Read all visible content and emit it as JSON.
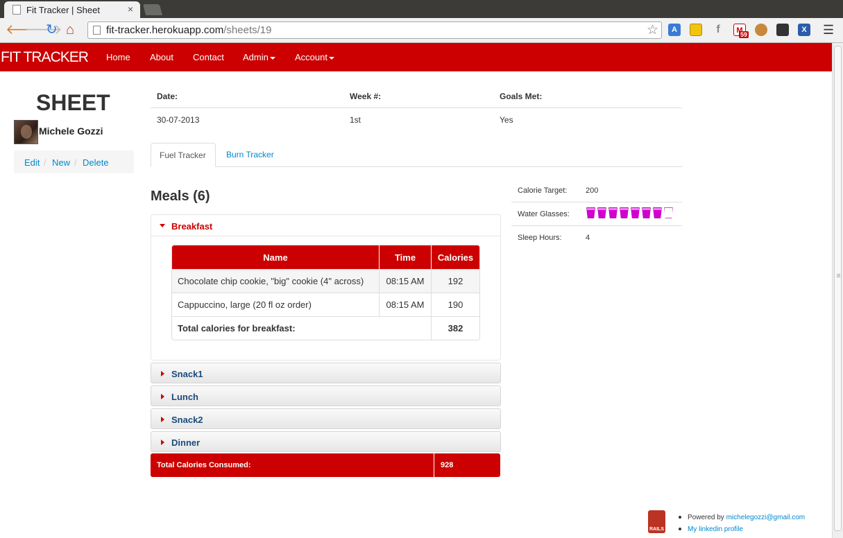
{
  "browser": {
    "tab_title": "Fit Tracker | Sheet",
    "url_host": "fit-tracker.herokuapp.com",
    "url_path": "/sheets/19",
    "gmail_badge": "59"
  },
  "nav": {
    "brand": "FIT TRACKER",
    "links": [
      "Home",
      "About",
      "Contact",
      "Admin",
      "Account"
    ]
  },
  "sheet": {
    "title": "SHEET",
    "user": "Michele Gozzi",
    "actions": [
      "Edit",
      "New",
      "Delete"
    ],
    "separator": "/",
    "info_headers": [
      "Date:",
      "Week #:",
      "Goals Met:"
    ],
    "info_values": [
      "30-07-2013",
      "1st",
      "Yes"
    ]
  },
  "tabs": [
    "Fuel Tracker",
    "Burn Tracker"
  ],
  "meals": {
    "title": "Meals (6)",
    "breakfast": {
      "label": "Breakfast",
      "columns": [
        "Name",
        "Time",
        "Calories"
      ],
      "rows": [
        {
          "name": "Chocolate chip cookie, \"big\" cookie (4\" across)",
          "time": "08:15 AM",
          "calories": "192"
        },
        {
          "name": "Cappuccino, large (20 fl oz order)",
          "time": "08:15 AM",
          "calories": "190"
        }
      ],
      "total_label": "Total calories for breakfast:",
      "total_value": "382"
    },
    "collapsed": [
      "Snack1",
      "Lunch",
      "Snack2",
      "Dinner"
    ],
    "total_label": "Total Calories Consumed:",
    "total_value": "928"
  },
  "stats": {
    "calorie_target_label": "Calorie Target:",
    "calorie_target_value": "200",
    "water_label": "Water Glasses:",
    "water_filled": 7,
    "water_total": 8,
    "sleep_label": "Sleep Hours:",
    "sleep_value": "4"
  },
  "footer": {
    "powered_by": "Powered by",
    "email": "michelegozzi@gmail.com",
    "linkedin": "My linkedin profile",
    "rails_text": "RAILS"
  },
  "colors": {
    "brand_red": "#cc0000",
    "link_blue": "#0088cc",
    "water_pink": "#d000d0"
  }
}
